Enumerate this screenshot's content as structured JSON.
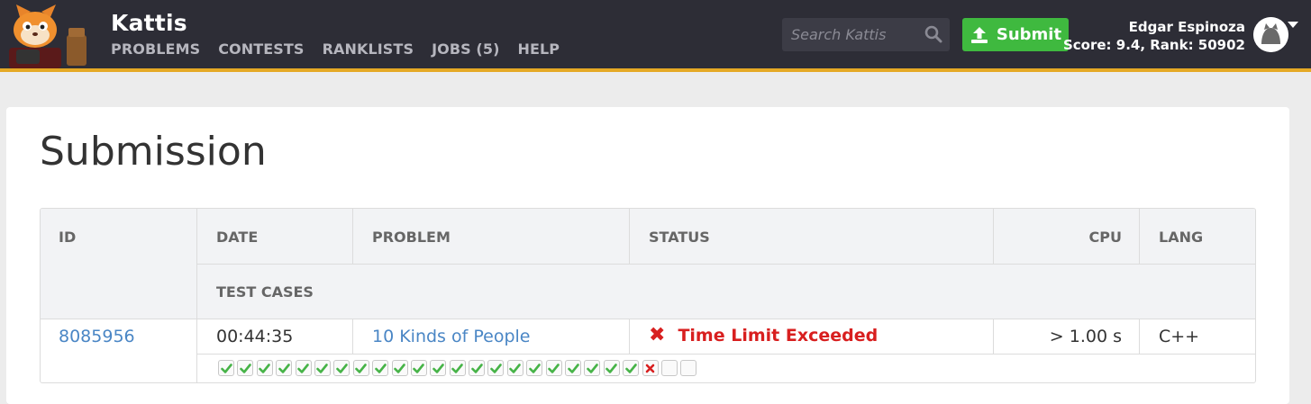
{
  "header": {
    "brand": "Kattis",
    "nav": [
      "PROBLEMS",
      "CONTESTS",
      "RANKLISTS",
      "JOBS (5)",
      "HELP"
    ],
    "search_placeholder": "Search Kattis",
    "submit_label": "Submit",
    "user_name": "Edgar Espinoza",
    "user_score": "Score: 9.4, Rank: 50902",
    "colors": {
      "bar": "#2d2d36",
      "accent": "#e5a925",
      "submit": "#3fb93f"
    }
  },
  "page": {
    "title": "Submission"
  },
  "table": {
    "headers": {
      "id": "ID",
      "date": "DATE",
      "problem": "PROBLEM",
      "status": "STATUS",
      "cpu": "CPU",
      "lang": "LANG",
      "test_cases": "TEST CASES"
    },
    "row": {
      "id": "8085956",
      "date": "00:44:35",
      "problem": "10 Kinds of People",
      "status": "Time Limit Exceeded",
      "cpu": "> 1.00 s",
      "lang": "C++"
    },
    "test_cases": [
      "pass",
      "pass",
      "pass",
      "pass",
      "pass",
      "pass",
      "pass",
      "pass",
      "pass",
      "pass",
      "pass",
      "pass",
      "pass",
      "pass",
      "pass",
      "pass",
      "pass",
      "pass",
      "pass",
      "pass",
      "pass",
      "pass",
      "fail",
      "none",
      "none"
    ],
    "status_color": "#d81f1f"
  },
  "icons": {
    "logo": "kattis-cat-logo-icon",
    "search": "search-icon",
    "upload": "upload-icon",
    "avatar": "user-avatar-icon",
    "caret": "caret-down-icon",
    "fail": "x-mark-icon",
    "pass": "check-icon"
  }
}
